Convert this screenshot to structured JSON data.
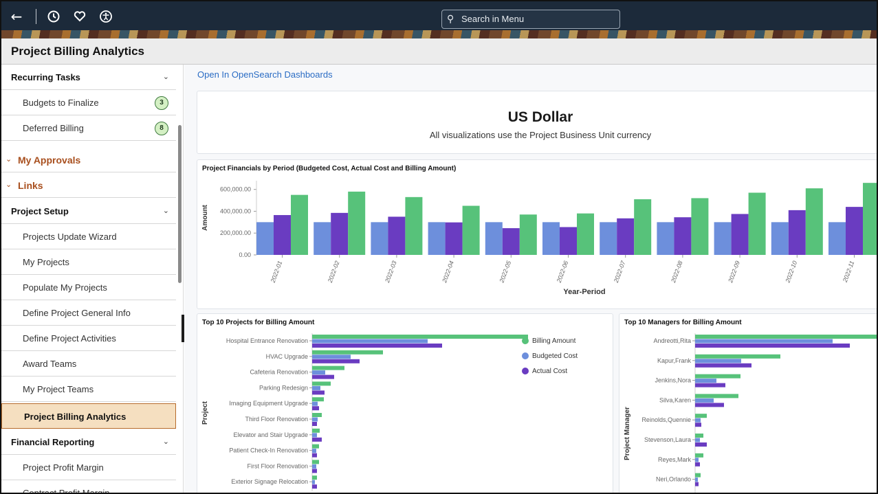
{
  "topbar": {
    "back_icon": "arrow-left-icon",
    "history_icon": "clock-icon",
    "favorites_icon": "heart-icon",
    "accessibility_icon": "accessibility-icon",
    "search_placeholder": "Search in Menu"
  },
  "page": {
    "title": "Project Billing Analytics"
  },
  "sidebar": {
    "recurring_tasks": "Recurring Tasks",
    "budgets_to_finalize": "Budgets to Finalize",
    "budgets_count": "3",
    "deferred_billing": "Deferred Billing",
    "deferred_count": "8",
    "my_approvals": "My Approvals",
    "links": "Links",
    "project_setup": "Project Setup",
    "projects_update_wizard": "Projects Update Wizard",
    "my_projects": "My Projects",
    "populate_my_projects": "Populate My Projects",
    "define_general_info": "Define Project General Info",
    "define_activities": "Define Project Activities",
    "award_teams": "Award Teams",
    "my_project_teams": "My Project Teams",
    "project_billing_analytics": "Project Billing Analytics",
    "financial_reporting": "Financial Reporting",
    "project_profit_margin": "Project Profit Margin",
    "contract_profit_margin": "Contract Profit Margin"
  },
  "main": {
    "open_link": "Open In OpenSearch Dashboards",
    "currency_title": "US Dollar",
    "currency_sub": "All visualizations use the Project Business Unit currency"
  },
  "colors": {
    "budgeted": "#6d8fdc",
    "actual": "#6a3cc1",
    "billing": "#57c27a"
  },
  "chart_data": [
    {
      "type": "bar",
      "title": "Project Financials by Period (Budgeted Cost, Actual Cost and Billing Amount)",
      "xlabel": "Year-Period",
      "ylabel": "Amount",
      "ylim": [
        0,
        680000
      ],
      "yticks": [
        "0.00",
        "200,000.00",
        "400,000.00",
        "600,000.00"
      ],
      "categories": [
        "2022-01",
        "2022-02",
        "2022-03",
        "2022-04",
        "2022-05",
        "2022-06",
        "2022-07",
        "2022-08",
        "2022-09",
        "2022-10",
        "2022-11"
      ],
      "series": [
        {
          "name": "Budgeted Cost",
          "values": [
            300000,
            300000,
            300000,
            300000,
            300000,
            300000,
            300000,
            300000,
            300000,
            300000,
            300000
          ]
        },
        {
          "name": "Actual Cost",
          "values": [
            365000,
            385000,
            350000,
            298000,
            245000,
            255000,
            335000,
            345000,
            375000,
            410000,
            440000
          ]
        },
        {
          "name": "Billing Amount",
          "values": [
            550000,
            580000,
            530000,
            450000,
            370000,
            380000,
            510000,
            520000,
            570000,
            610000,
            660000
          ]
        }
      ]
    },
    {
      "type": "bar",
      "orientation": "horizontal",
      "title": "Top 10 Projects for Billing Amount",
      "ylabel": "Project",
      "legend_position": "top-right",
      "categories": [
        "Hospital Entrance Renovation",
        "HVAC Upgrade",
        "Cafeteria Renovation",
        "Parking Redesign",
        "Imaging Equipment Upgrade",
        "Third Floor Renovation",
        "Elevator and Stair Upgrade",
        "Patient Check-In Renovation",
        "First Floor Renovation",
        "Exterior Signage Relocation"
      ],
      "series": [
        {
          "name": "Billing Amount",
          "values": [
            314,
            103,
            47,
            27,
            17,
            14,
            11,
            10,
            10,
            7
          ]
        },
        {
          "name": "Budgeted Cost",
          "values": [
            168,
            56,
            19,
            12,
            8,
            8,
            7,
            6,
            6,
            4
          ]
        },
        {
          "name": "Actual Cost",
          "values": [
            189,
            69,
            32,
            18,
            10,
            7,
            14,
            7,
            7,
            7
          ]
        }
      ]
    },
    {
      "type": "bar",
      "orientation": "horizontal",
      "title": "Top 10 Managers for Billing Amount",
      "ylabel": "Project Manager",
      "categories": [
        "Andreotti,Rita",
        "Kapur,Frank",
        "Jenkins,Nora",
        "Silva,Karen",
        "Reinolds,Quennie",
        "Stevenson,Laura",
        "Reyes,Mark",
        "Neri,Orlando"
      ],
      "series": [
        {
          "name": "Billing Amount",
          "values": [
            270,
            124,
            66,
            63,
            17,
            12,
            12,
            8
          ]
        },
        {
          "name": "Budgeted Cost",
          "values": [
            200,
            67,
            31,
            27,
            8,
            7,
            5,
            4
          ]
        },
        {
          "name": "Actual Cost",
          "values": [
            225,
            82,
            44,
            42,
            9,
            17,
            7,
            5
          ]
        }
      ]
    }
  ]
}
